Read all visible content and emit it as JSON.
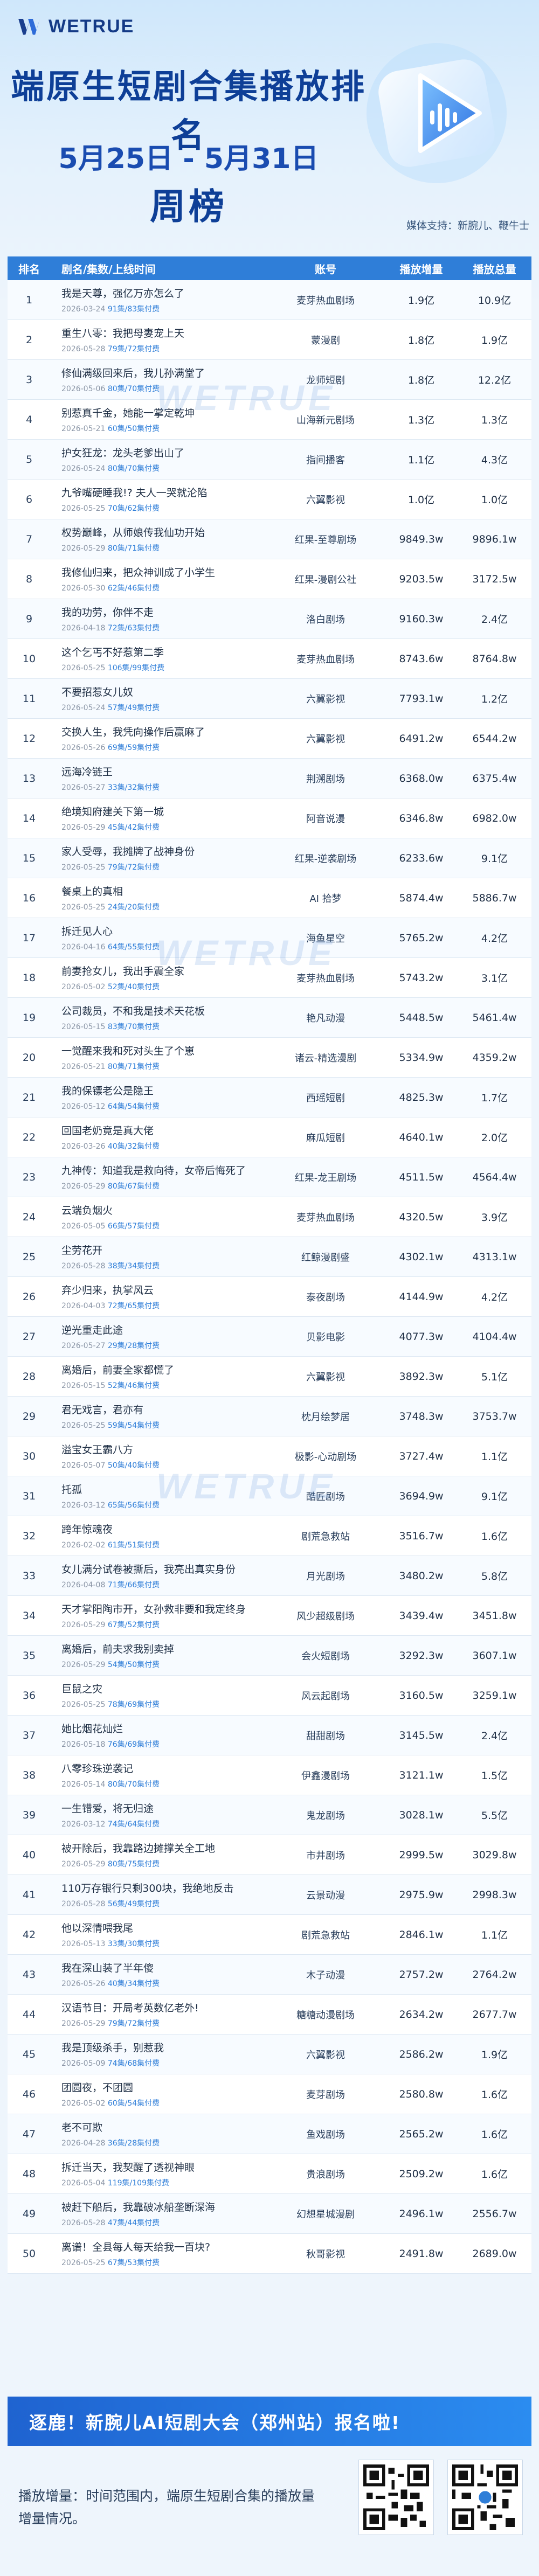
{
  "header": {
    "logo": "WETRUE",
    "title": "端原生短剧合集播放排名",
    "date_range": "5月25日 - 5月31日",
    "period": "周榜",
    "support": "媒体支持：新腕儿、鞭牛士"
  },
  "table": {
    "columns": [
      "排名",
      "剧名/集数/上线时间",
      "账号",
      "播放增量",
      "播放总量"
    ],
    "rows": [
      {
        "rank": "1",
        "title": "我是天尊，强亿万亦怎么了",
        "date": "2026-03-24",
        "eps": "91集/83集付费",
        "account": "麦芽热血剧场",
        "inc": "1.9亿",
        "total": "10.9亿"
      },
      {
        "rank": "2",
        "title": "重生八零：我把母妻宠上天",
        "date": "2026-05-28",
        "eps": "79集/72集付费",
        "account": "蒙漫剧",
        "inc": "1.8亿",
        "total": "1.9亿"
      },
      {
        "rank": "3",
        "title": "修仙满级回来后，我儿孙满堂了",
        "date": "2026-05-06",
        "eps": "80集/70集付费",
        "account": "龙师短剧",
        "inc": "1.8亿",
        "total": "12.2亿"
      },
      {
        "rank": "4",
        "title": "别惹真千金，她能一掌定乾坤",
        "date": "2026-05-21",
        "eps": "60集/50集付费",
        "account": "山海新元剧场",
        "inc": "1.3亿",
        "total": "1.3亿"
      },
      {
        "rank": "5",
        "title": "护女狂龙：龙头老爹出山了",
        "date": "2026-05-24",
        "eps": "80集/70集付费",
        "account": "指间播客",
        "inc": "1.1亿",
        "total": "4.3亿"
      },
      {
        "rank": "6",
        "title": "九爷嘴硬睡我!? 夫人一哭就沦陷",
        "date": "2026-05-25",
        "eps": "70集/62集付费",
        "account": "六翼影视",
        "inc": "1.0亿",
        "total": "1.0亿"
      },
      {
        "rank": "7",
        "title": "权势巅峰，从师娘传我仙功开始",
        "date": "2026-05-29",
        "eds": "",
        "eps": "80集/71集付费",
        "account": "红果-至尊剧场",
        "inc": "9849.3w",
        "total": "9896.1w"
      },
      {
        "rank": "8",
        "title": "我修仙归来，把众神训成了小学生",
        "date": "2026-05-30",
        "eps": "62集/46集付费",
        "account": "红果-漫剧公社",
        "inc": "9203.5w",
        "total": "3172.5w"
      },
      {
        "rank": "9",
        "title": "我的功劳，你伴不走",
        "date": "2026-04-18",
        "eps": "72集/63集付费",
        "account": "洛白剧场",
        "inc": "9160.3w",
        "total": "2.4亿"
      },
      {
        "rank": "10",
        "title": "这个乞丐不好惹第二季",
        "date": "2026-05-25",
        "eps": "106集/99集付费",
        "account": "麦芽热血剧场",
        "inc": "8743.6w",
        "total": "8764.8w"
      },
      {
        "rank": "11",
        "title": "不要招惹女儿奴",
        "date": "2026-05-24",
        "eps": "57集/49集付费",
        "account": "六翼影视",
        "inc": "7793.1w",
        "total": "1.2亿"
      },
      {
        "rank": "12",
        "title": "交换人生，我凭向操作后赢麻了",
        "date": "2026-05-26",
        "eps": "69集/59集付费",
        "account": "六翼影视",
        "inc": "6491.2w",
        "total": "6544.2w"
      },
      {
        "rank": "13",
        "title": "远海冷链王",
        "date": "2026-05-27",
        "eps": "33集/32集付费",
        "account": "荆溯剧场",
        "inc": "6368.0w",
        "total": "6375.4w"
      },
      {
        "rank": "14",
        "title": "绝境知府建关下第一城",
        "date": "2026-05-29",
        "eps": "45集/42集付费",
        "account": "阿音说漫",
        "inc": "6346.8w",
        "total": "6982.0w"
      },
      {
        "rank": "15",
        "title": "家人受辱，我摊牌了战神身份",
        "date": "2026-05-25",
        "eps": "79集/72集付费",
        "account": "红果-逆袭剧场",
        "inc": "6233.6w",
        "total": "9.1亿"
      },
      {
        "rank": "16",
        "title": "餐桌上的真相",
        "date": "2026-05-25",
        "eps": "24集/20集付费",
        "account": "AI 拾梦",
        "inc": "5874.4w",
        "total": "5886.7w"
      },
      {
        "rank": "17",
        "title": "拆迁见人心",
        "date": "2026-04-16",
        "eps": "64集/55集付费",
        "account": "海鱼星空",
        "inc": "5765.2w",
        "total": "4.2亿"
      },
      {
        "rank": "18",
        "title": "前妻抢女儿，我出手震全家",
        "date": "2026-05-02",
        "eps": "52集/40集付费",
        "account": "麦芽热血剧场",
        "inc": "5743.2w",
        "total": "3.1亿"
      },
      {
        "rank": "19",
        "title": "公司裁员，不和我是技术天花板",
        "date": "2026-05-15",
        "eps": "83集/70集付费",
        "account": "艳凡动漫",
        "inc": "5448.5w",
        "total": "5461.4w"
      },
      {
        "rank": "20",
        "title": "一觉醒来我和死对头生了个崽",
        "date": "2026-05-21",
        "eps": "80集/71集付费",
        "account": "诸云-精选漫剧",
        "inc": "5334.9w",
        "total": "4359.2w"
      },
      {
        "rank": "21",
        "title": "我的保镖老公是隐王",
        "date": "2026-05-12",
        "eps": "64集/54集付费",
        "account": "西瑶短剧",
        "inc": "4825.3w",
        "total": "1.7亿"
      },
      {
        "rank": "22",
        "title": "回国老奶竟是真大佬",
        "date": "2026-03-26",
        "eps": "40集/32集付费",
        "account": "麻瓜短剧",
        "inc": "4640.1w",
        "total": "2.0亿"
      },
      {
        "rank": "23",
        "title": "九神传：知道我是救向待，女帝后悔死了",
        "date": "2026-05-29",
        "eps": "80集/67集付费",
        "account": "红果-龙王剧场",
        "inc": "4511.5w",
        "total": "4564.4w"
      },
      {
        "rank": "24",
        "title": "云端负烟火",
        "date": "2026-05-05",
        "eps": "66集/57集付费",
        "account": "麦芽热血剧场",
        "inc": "4320.5w",
        "total": "3.9亿"
      },
      {
        "rank": "25",
        "title": "尘劳花开",
        "date": "2026-05-28",
        "eps": "38集/34集付费",
        "account": "红鲸漫剧盛",
        "inc": "4302.1w",
        "total": "4313.1w"
      },
      {
        "rank": "26",
        "title": "弃少归来，执掌风云",
        "date": "2026-04-03",
        "eps": "72集/65集付费",
        "account": "泰夜剧场",
        "inc": "4144.9w",
        "total": "4.2亿"
      },
      {
        "rank": "27",
        "title": "逆光重走此途",
        "date": "2026-05-27",
        "eps": "29集/28集付费",
        "account": "贝影电影",
        "inc": "4077.3w",
        "total": "4104.4w"
      },
      {
        "rank": "28",
        "title": "离婚后，前妻全家都慌了",
        "date": "2026-05-15",
        "eps": "52集/46集付费",
        "account": "六翼影视",
        "inc": "3892.3w",
        "total": "5.1亿"
      },
      {
        "rank": "29",
        "title": "君无戏言，君亦有",
        "date": "2026-05-25",
        "eps": "59集/54集付费",
        "account": "枕月绘梦居",
        "inc": "3748.3w",
        "total": "3753.7w"
      },
      {
        "rank": "30",
        "title": "溢宝女王霸八方",
        "date": "2026-05-07",
        "eps": "50集/40集付费",
        "account": "极影-心动剧场",
        "inc": "3727.4w",
        "total": "1.1亿"
      },
      {
        "rank": "31",
        "title": "托孤",
        "date": "2026-03-12",
        "eps": "65集/56集付费",
        "account": "酷匠剧场",
        "inc": "3694.9w",
        "total": "9.1亿"
      },
      {
        "rank": "32",
        "title": "跨年惊魂夜",
        "date": "2026-02-02",
        "eps": "61集/51集付费",
        "account": "剧荒急救站",
        "inc": "3516.7w",
        "total": "1.6亿"
      },
      {
        "rank": "33",
        "title": "女儿满分试卷被撕后，我亮出真实身份",
        "date": "2026-04-08",
        "eps": "71集/66集付费",
        "account": "月光剧场",
        "inc": "3480.2w",
        "total": "5.8亿"
      },
      {
        "rank": "34",
        "title": "天才掌阳陶市开，女孙救非要和我定终身",
        "date": "2026-05-29",
        "eps": "67集/52集付费",
        "account": "风少超级剧场",
        "inc": "3439.4w",
        "total": "3451.8w"
      },
      {
        "rank": "35",
        "title": "离婚后，前夫求我别卖掉",
        "date": "2026-05-29",
        "eps": "54集/50集付费",
        "account": "会火短剧场",
        "inc": "3292.3w",
        "total": "3607.1w"
      },
      {
        "rank": "36",
        "title": "巨鼠之灾",
        "date": "2026-05-25",
        "eps": "78集/69集付费",
        "account": "风云起剧场",
        "inc": "3160.5w",
        "total": "3259.1w"
      },
      {
        "rank": "37",
        "title": "她比烟花灿烂",
        "date": "2026-05-18",
        "eps": "76集/69集付费",
        "account": "甜甜剧场",
        "inc": "3145.5w",
        "total": "2.4亿"
      },
      {
        "rank": "38",
        "title": "八零珍珠逆袭记",
        "date": "2026-05-14",
        "eps": "80集/70集付费",
        "account": "伊鑫漫剧场",
        "inc": "3121.1w",
        "total": "1.5亿"
      },
      {
        "rank": "39",
        "title": "一生错爱，将无归途",
        "date": "2026-03-12",
        "eps": "74集/64集付费",
        "account": "鬼龙剧场",
        "inc": "3028.1w",
        "total": "5.5亿"
      },
      {
        "rank": "40",
        "title": "被开除后，我靠路边摊撑关全工地",
        "date": "2026-05-29",
        "eps": "80集/75集付费",
        "account": "市井剧场",
        "inc": "2999.5w",
        "total": "3029.8w"
      },
      {
        "rank": "41",
        "title": "110万存银行只剩300块，我绝地反击",
        "date": "2026-05-28",
        "eps": "56集/49集付费",
        "account": "云景动漫",
        "inc": "2975.9w",
        "total": "2998.3w"
      },
      {
        "rank": "42",
        "title": "他以深情喂我尾",
        "date": "2026-05-13",
        "eps": "33集/30集付费",
        "account": "剧荒急救站",
        "inc": "2846.1w",
        "total": "1.1亿"
      },
      {
        "rank": "43",
        "title": "我在深山装了半年傻",
        "date": "2026-05-26",
        "eps": "40集/34集付费",
        "account": "木子动漫",
        "inc": "2757.2w",
        "total": "2764.2w"
      },
      {
        "rank": "44",
        "title": "汉语节目：开局考英数亿老外!",
        "date": "2026-05-29",
        "eps": "79集/72集付费",
        "account": "糖糖动漫剧场",
        "inc": "2634.2w",
        "total": "2677.7w"
      },
      {
        "rank": "45",
        "title": "我是顶级杀手，别惹我",
        "date": "2026-05-09",
        "eps": "74集/68集付费",
        "account": "六翼影视",
        "inc": "2586.2w",
        "total": "1.9亿"
      },
      {
        "rank": "46",
        "title": "团圆夜，不团圆",
        "date": "2026-05-02",
        "eps": "60集/54集付费",
        "account": "麦芽剧场",
        "inc": "2580.8w",
        "total": "1.6亿"
      },
      {
        "rank": "47",
        "title": "老不可欺",
        "date": "2026-04-28",
        "eps": "36集/28集付费",
        "account": "鱼戏剧场",
        "inc": "2565.2w",
        "total": "1.6亿"
      },
      {
        "rank": "48",
        "title": "拆迁当天，我契醒了透视神眼",
        "date": "2026-05-04",
        "eps": "119集/109集付费",
        "account": "贵浪剧场",
        "inc": "2509.2w",
        "total": "1.6亿"
      },
      {
        "rank": "49",
        "title": "被赶下船后，我靠破冰船垄断深海",
        "date": "2026-05-28",
        "eps": "47集/44集付费",
        "account": "幻想星城漫剧",
        "inc": "2496.1w",
        "total": "2556.7w"
      },
      {
        "rank": "50",
        "title": "离谱！全县每人每天给我一百块?",
        "date": "2026-05-25",
        "eps": "67集/53集付费",
        "account": "秋哥影视",
        "inc": "2491.8w",
        "total": "2689.0w"
      }
    ]
  },
  "watermark": "WETRUE",
  "banner": "逐鹿！新腕儿AI短剧大会（郑州站）报名啦!",
  "footnote": "播放增量：时间范围内，端原生短剧合集的播放量增量情况。",
  "colors": {
    "primary": "#2f7ed8",
    "title": "#0e3f97",
    "banner": "#1f63d0"
  }
}
